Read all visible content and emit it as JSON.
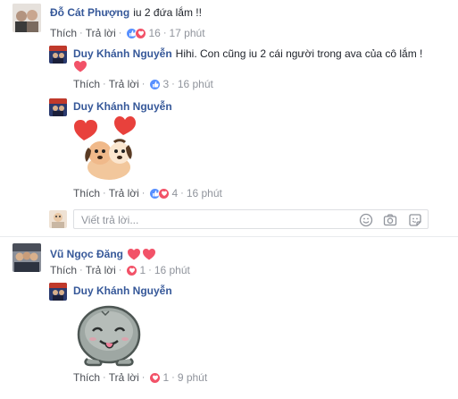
{
  "comments": [
    {
      "author": "Đỗ Cát Phượng",
      "text": "iu 2 đứa lắm !!",
      "like_label": "Thích",
      "reply_label": "Trả lời",
      "reaction_count": "16",
      "time": "17 phút",
      "replies": [
        {
          "author": "Duy Khánh Nguyễn",
          "text": "Hihi. Con cũng iu 2 cái người trong ava của cô lắm !",
          "like_label": "Thích",
          "reply_label": "Trả lời",
          "reaction_count": "3",
          "time": "16 phút"
        },
        {
          "author": "Duy Khánh Nguyễn",
          "sticker": "dogs-with-hearts-sticker",
          "like_label": "Thích",
          "reply_label": "Trả lời",
          "reaction_count": "4",
          "time": "16 phút"
        }
      ],
      "reply_box": {
        "placeholder": "Viết trả lời..."
      }
    },
    {
      "author": "Vũ Ngọc Đăng",
      "like_label": "Thích",
      "reply_label": "Trả lời",
      "reaction_count": "1",
      "time": "16 phút",
      "replies": [
        {
          "author": "Duy Khánh Nguyễn",
          "sticker": "grey-blob-tongue-sticker",
          "like_label": "Thích",
          "reply_label": "Trả lời",
          "reaction_count": "1",
          "time": "9 phút"
        }
      ]
    }
  ],
  "dot": "·",
  "colors": {
    "name": "#365899",
    "like": "#5890ff",
    "love": "#f25268",
    "haha": "#f7b125"
  }
}
